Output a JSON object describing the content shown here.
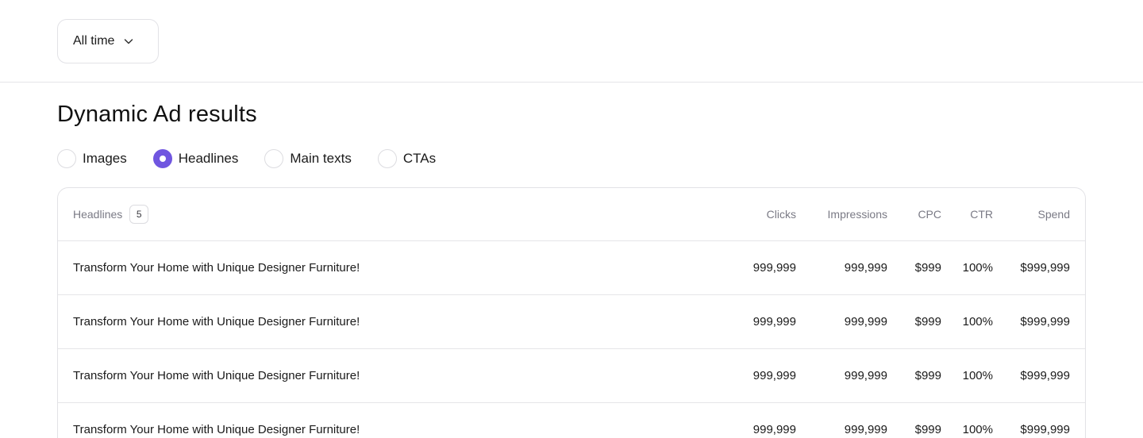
{
  "filter": {
    "selected": "All time",
    "icon": "chevron-down-icon"
  },
  "page_title": "Dynamic Ad results",
  "tabs": [
    {
      "label": "Images",
      "checked": false
    },
    {
      "label": "Headlines",
      "checked": true
    },
    {
      "label": "Main texts",
      "checked": false
    },
    {
      "label": "CTAs",
      "checked": false
    }
  ],
  "colors": {
    "accent": "#7056e0",
    "border": "#e2e2e6",
    "muted_text": "#7a7a85"
  },
  "table": {
    "header": {
      "name": "Headlines",
      "count": "5",
      "clicks": "Clicks",
      "impressions": "Impressions",
      "cpc": "CPC",
      "ctr": "CTR",
      "spend": "Spend"
    },
    "rows": [
      {
        "name": "Transform Your Home with Unique Designer Furniture!",
        "clicks": "999,999",
        "impressions": "999,999",
        "cpc": "$999",
        "ctr": "100%",
        "spend": "$999,999"
      },
      {
        "name": "Transform Your Home with Unique Designer Furniture!",
        "clicks": "999,999",
        "impressions": "999,999",
        "cpc": "$999",
        "ctr": "100%",
        "spend": "$999,999"
      },
      {
        "name": "Transform Your Home with Unique Designer Furniture!",
        "clicks": "999,999",
        "impressions": "999,999",
        "cpc": "$999",
        "ctr": "100%",
        "spend": "$999,999"
      },
      {
        "name": "Transform Your Home with Unique Designer Furniture!",
        "clicks": "999,999",
        "impressions": "999,999",
        "cpc": "$999",
        "ctr": "100%",
        "spend": "$999,999"
      }
    ]
  }
}
